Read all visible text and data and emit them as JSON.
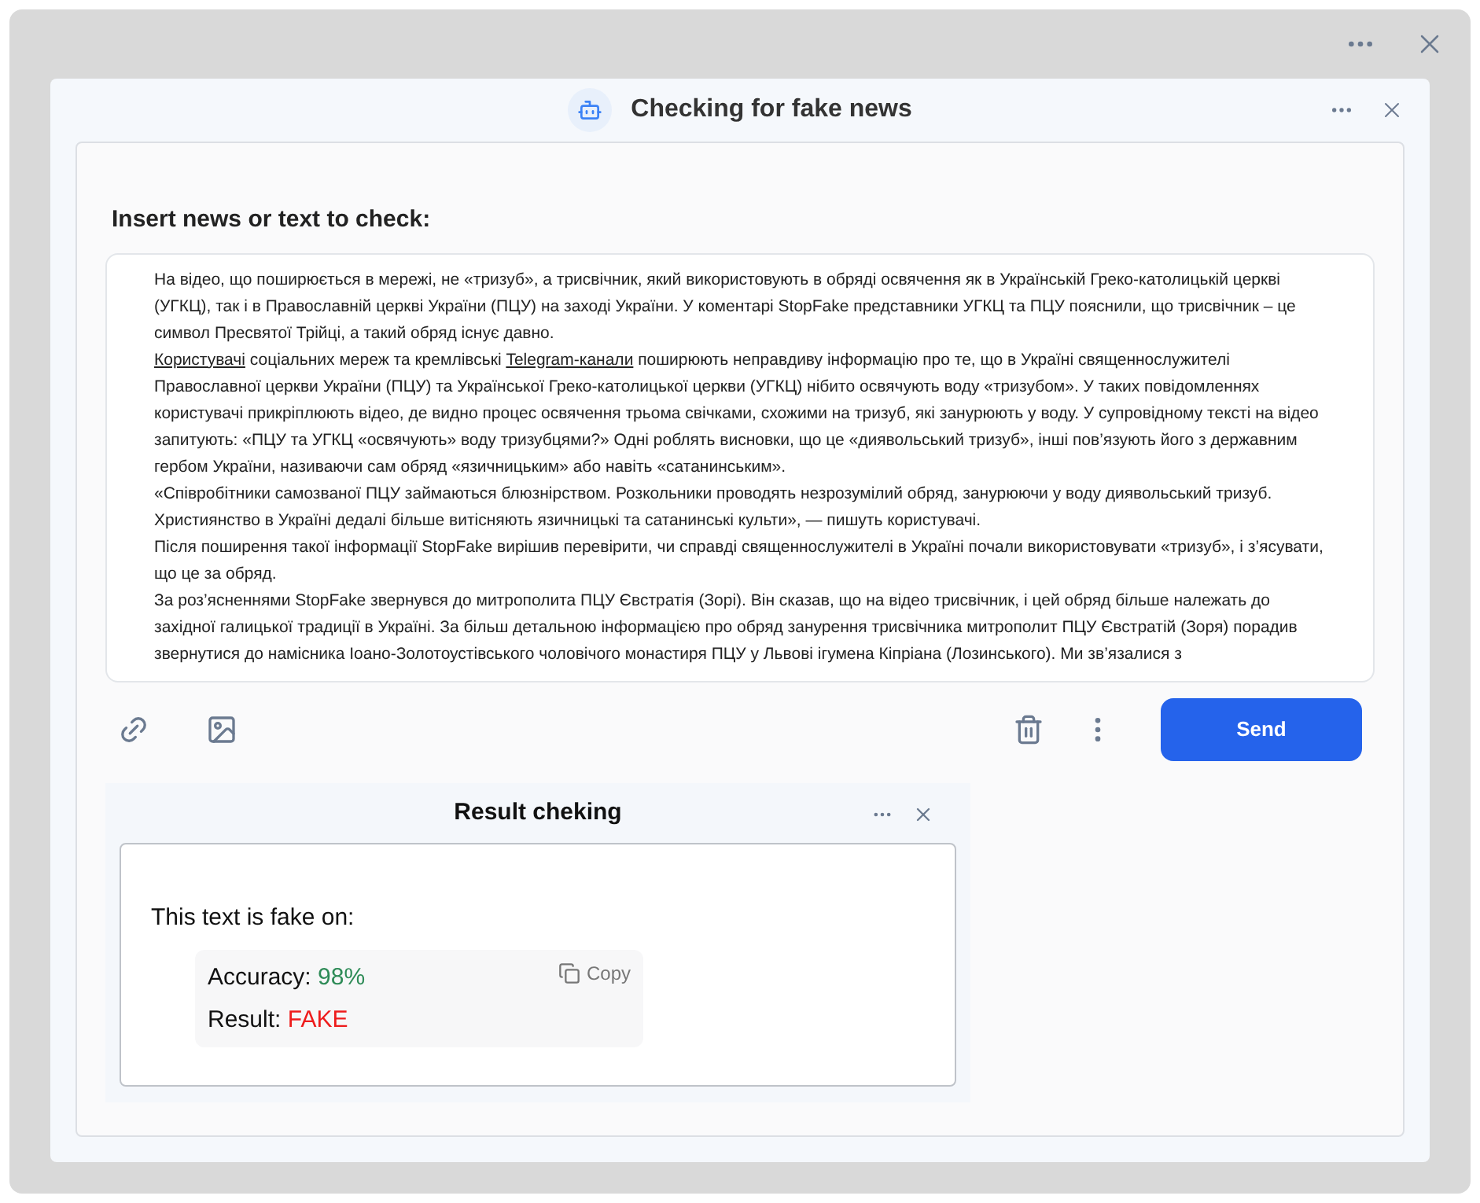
{
  "window": {
    "title": "Checking for fake news"
  },
  "input": {
    "label": "Insert news or text to check:",
    "paragraphs": [
      {
        "segments": [
          {
            "text": "На відео, що поширюється в мережі, не «тризуб», а трисвічник, який використовують в обряді освячення як в Українській Греко-католицькій церкві (УГКЦ), так і в Православній церкві України (ПЦУ) на заході України. У коментарі StopFake представники УГКЦ та ПЦУ пояснили, що трисвічник – це символ Пресвятої Трійці, а такий обряд існує давно.",
            "kind": "text"
          }
        ]
      },
      {
        "segments": [
          {
            "text": "Користувачі",
            "kind": "link"
          },
          {
            "text": " соціальних мереж та кремлівські ",
            "kind": "text"
          },
          {
            "text": "Telegram-канали",
            "kind": "link"
          },
          {
            "text": " поширюють неправдиву інформацію про те, що в Україні священнослужителі Православної церкви України (ПЦУ) та Української Греко-католицької церкви (УГКЦ) нібито освячують воду «тризубом». У таких повідомленнях користувачі прикріплюють відео, де видно процес освячення трьома свічками, схожими на тризуб, які занурюють у воду. У супровідному тексті на відео запитують: «ПЦУ та УГКЦ «освячують» воду тризубцями?» Одні роблять висновки, що це «диявольський тризуб», інші пов’язують його з державним гербом України, називаючи сам обряд «язичницьким» або навіть «сатанинським».",
            "kind": "text"
          }
        ]
      },
      {
        "segments": [
          {
            "text": "«Співробітники самозваної ПЦУ займаються блюзнірством. Розкольники проводять незрозумілий обряд, занурюючи у воду диявольський тризуб. Християнство в Україні дедалі більше витісняють язичницькі та сатанинські культи», — пишуть користувачі.",
            "kind": "text"
          }
        ]
      },
      {
        "segments": [
          {
            "text": "Після поширення такої інформації StopFake вирішив перевірити, чи справді священнослужителі в Україні почали використовувати «тризуб», і з’ясувати, що це за обряд.",
            "kind": "text"
          }
        ]
      },
      {
        "segments": [
          {
            "text": "За роз’ясненнями StopFake звернувся до митрополита ПЦУ Євстратія (Зорі). Він сказав, що на відео трисвічник, і цей обряд більше належать до західної галицької традиції в Україні. За більш детальною інформацією про обряд занурення трисвічника митрополит ПЦУ Євстратій (Зоря) порадив звернутися до намісника Іоано-Золотоустівського чоловічого монастиря ПЦУ у Львові ігумена Кіпріана (Лозинського). Ми зв’язалися з",
            "kind": "text"
          }
        ]
      }
    ]
  },
  "send_button": "Send",
  "result": {
    "title": "Result cheking",
    "heading": "This text is fake on:",
    "copy": "Copy",
    "lines": [
      {
        "label": "Accuracy:",
        "value": "98%",
        "color": "#2e8b57"
      },
      {
        "label": "Result:",
        "value": "FAKE",
        "color": "#ee1c1c"
      }
    ]
  }
}
